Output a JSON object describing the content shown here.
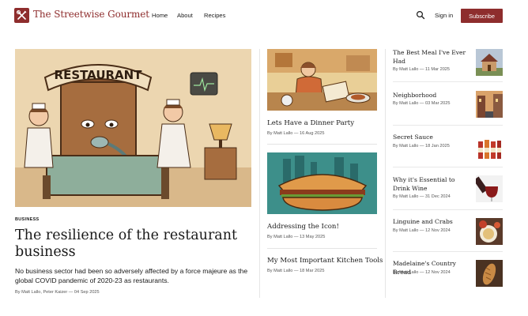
{
  "site": {
    "title": "The Streetwise Gourmet"
  },
  "nav": {
    "home": "Home",
    "about": "About",
    "recipes": "Recipes"
  },
  "header": {
    "signin": "Sign in",
    "subscribe": "Subscribe"
  },
  "hero": {
    "category": "BUSINESS",
    "title": "The resilience of the restaurant business",
    "description": "No business sector had been so adversely affected by a force majeure as the global COVID pandemic of 2020-23 as restaurants.",
    "meta": "By Matt Lallo, Peter Kaizer — 04 Sep 2025",
    "sign_text": "RESTAURANT"
  },
  "middle": [
    {
      "title": "Lets Have a Dinner Party",
      "meta": "By Matt Lallo — 16 Aug 2025",
      "image_icon": "dinner-party-illustration"
    },
    {
      "title": "Addressing the Icon!",
      "meta": "By Matt Lallo — 13 May 2025",
      "image_icon": "sandwich-illustration"
    },
    {
      "title": "My Most Important Kitchen Tools",
      "meta": "By Matt Lallo — 18 Mar 2025"
    }
  ],
  "sidebar": [
    {
      "title": "The Best Meal I've Ever Had",
      "meta": "By Matt Lallo — 11 Mar 2025",
      "thumb_icon": "house-icon"
    },
    {
      "title": "Neighborhood",
      "meta": "By Matt Lallo — 03 Mar 2025",
      "thumb_icon": "street-icon"
    },
    {
      "title": "Secret Sauce",
      "meta": "By Matt Lallo — 18 Jan 2025",
      "thumb_icon": "sauce-bottles-icon"
    },
    {
      "title": "Why it's Essential to Drink Wine",
      "meta": "By Matt Lallo — 31 Dec 2024",
      "thumb_icon": "wine-icon"
    },
    {
      "title": "Linguine and Crabs",
      "meta": "By Matt Lallo — 12 Nov 2024",
      "thumb_icon": "crab-plate-icon"
    },
    {
      "title": "Madelaine's Country Bread",
      "meta": "By Matt Lallo — 12 Nov 2024",
      "thumb_icon": "bread-icon"
    }
  ],
  "colors": {
    "brand": "#8e2d2d",
    "text": "#1a1a1a",
    "meta": "#555555"
  }
}
